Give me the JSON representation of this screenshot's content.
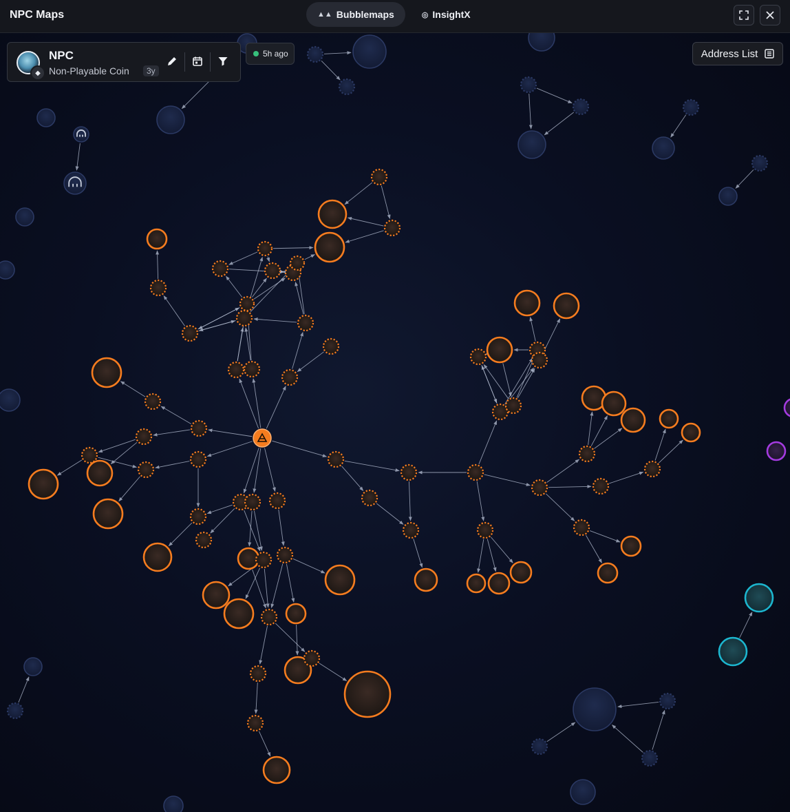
{
  "app": {
    "title": "NPC Maps"
  },
  "tabs": [
    {
      "label": "Bubblemaps",
      "icon": "bubblemaps-logo-icon",
      "active": true
    },
    {
      "label": "InsightX",
      "icon": "insightx-logo-icon",
      "active": false
    }
  ],
  "window_controls": [
    {
      "name": "fullscreen-button",
      "icon": "expand-icon"
    },
    {
      "name": "close-button",
      "icon": "close-icon"
    }
  ],
  "token": {
    "symbol": "NPC",
    "name": "Non-Playable Coin",
    "age": "3y",
    "chain_icon": "ethereum-icon",
    "actions": [
      "edit-icon",
      "calendar-icon",
      "filter-icon"
    ]
  },
  "status": {
    "text": "5h ago",
    "color": "#37c07c"
  },
  "address_list": {
    "label": "Address List",
    "icon": "list-icon"
  },
  "colors": {
    "cluster_orange": "#f57c1f",
    "cluster_purple": "#a43be0",
    "cluster_teal": "#1cb6cf",
    "neutral_bubble": "#1b2545",
    "link_arrow": "#b9c2d6"
  }
}
